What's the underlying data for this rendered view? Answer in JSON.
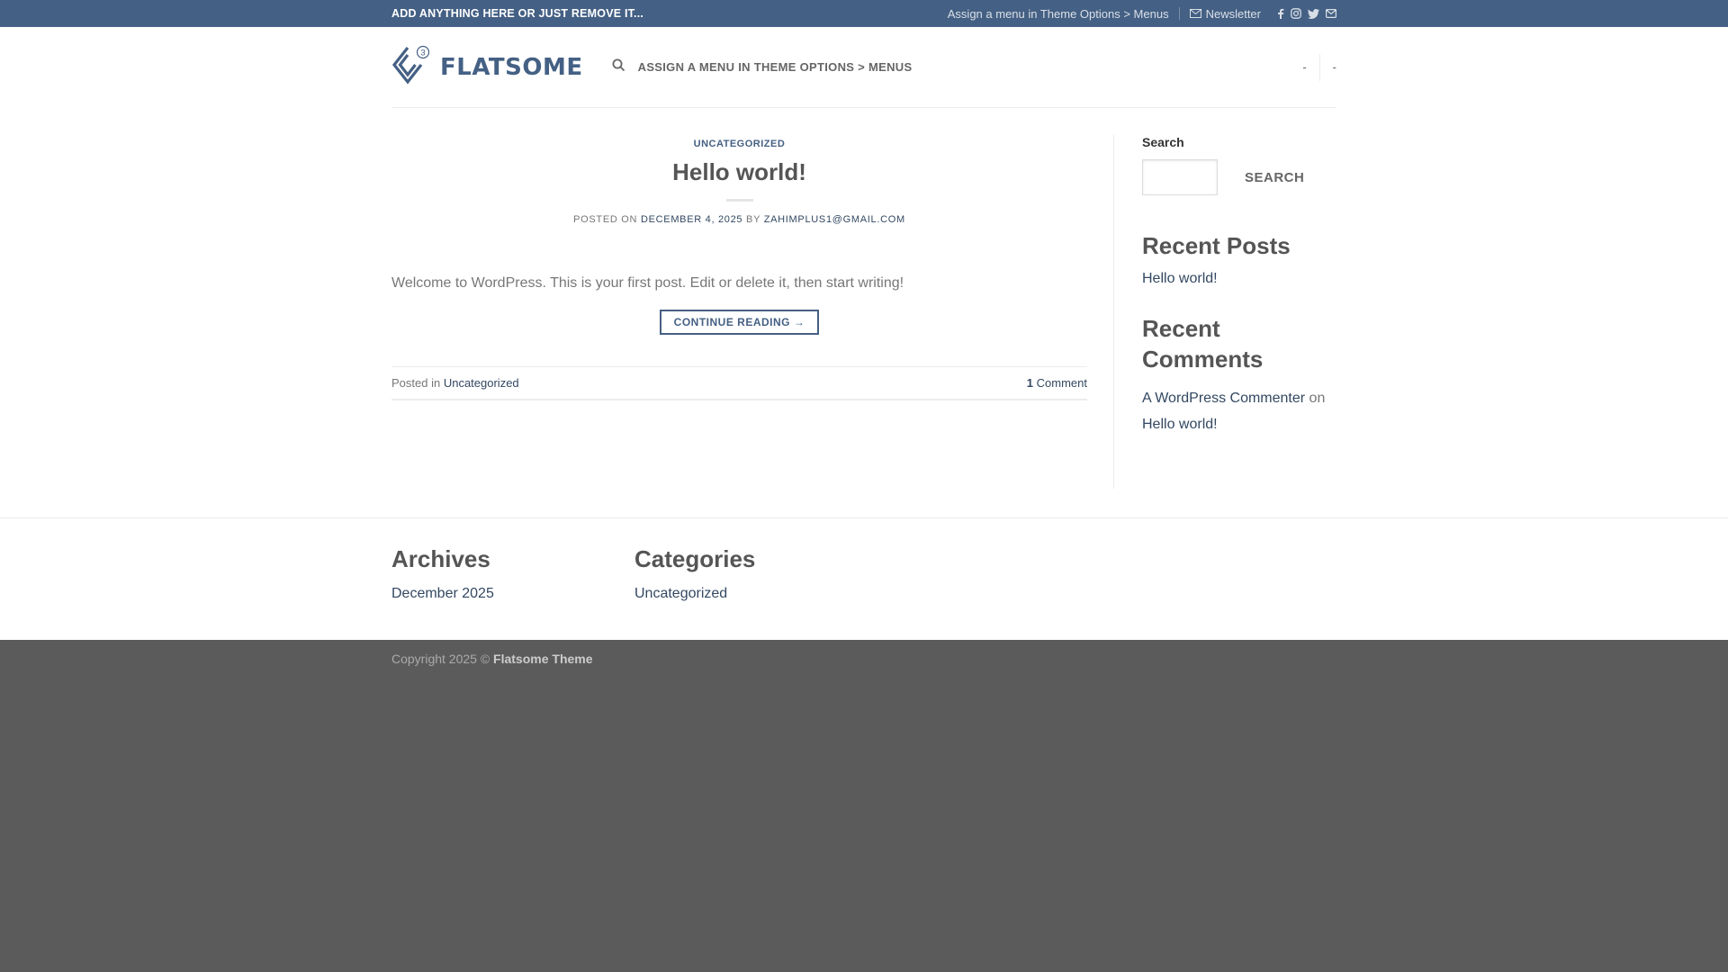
{
  "topbar": {
    "left_text": "ADD ANYTHING HERE OR JUST REMOVE IT...",
    "menu_hint": "Assign a menu in Theme Options > Menus",
    "newsletter": "Newsletter",
    "social_icons": [
      "facebook-icon",
      "instagram-icon",
      "twitter-icon",
      "envelope-icon"
    ]
  },
  "header": {
    "logo_text": "FLATSOME",
    "logo_badge": "3",
    "menu_hint": "ASSIGN A MENU IN THEME OPTIONS > MENUS",
    "right_items": [
      "-",
      "-"
    ]
  },
  "post": {
    "category": "UNCATEGORIZED",
    "title": "Hello world!",
    "meta_prefix": "POSTED ON",
    "date": "DECEMBER 4, 2025",
    "meta_by": "BY",
    "author": "ZAHIMPLUS1@GMAIL.COM",
    "excerpt": "Welcome to WordPress. This is your first post. Edit or delete it, then start writing!",
    "continue_label": "CONTINUE READING →",
    "posted_in": "Posted in",
    "posted_in_category": "Uncategorized",
    "comment_count": "1",
    "comment_label": "Comment"
  },
  "sidebar": {
    "search_label": "Search",
    "search_button": "SEARCH",
    "recent_posts_title": "Recent Posts",
    "recent_posts": [
      "Hello world!"
    ],
    "recent_comments_title": "Recent Comments",
    "comment_author": "A WordPress Commenter",
    "comment_on": "on",
    "comment_post": "Hello world!"
  },
  "footer": {
    "archives_title": "Archives",
    "archives_link": "December 2025",
    "categories_title": "Categories",
    "categories_link": "Uncategorized",
    "copyright_prefix": "Copyright 2025 ©",
    "copyright_brand": "Flatsome Theme"
  },
  "colors": {
    "primary": "#446084",
    "link": "#334862",
    "footer_bg": "#5b5b5b"
  }
}
